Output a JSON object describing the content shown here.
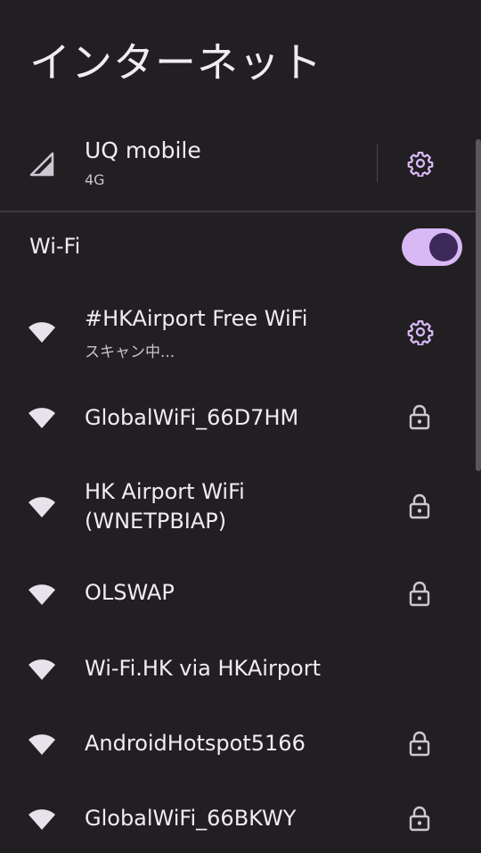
{
  "page": {
    "title": "インターネット"
  },
  "carrier": {
    "name": "UQ mobile",
    "network_type": "4G"
  },
  "wifi": {
    "label": "Wi-Fi",
    "enabled": true
  },
  "networks": [
    {
      "name": "#HKAirport Free WiFi",
      "status": "スキャン中...",
      "secured": false,
      "has_settings": true
    },
    {
      "name": "GlobalWiFi_66D7HM",
      "secured": true
    },
    {
      "name_line1": "HK Airport WiFi",
      "name_line2": "(WNETPBIAP)",
      "secured": true
    },
    {
      "name": "OLSWAP",
      "secured": true
    },
    {
      "name": "Wi-Fi.HK via HKAirport",
      "secured": false
    },
    {
      "name": "AndroidHotspot5166",
      "secured": true
    },
    {
      "name": "GlobalWiFi_66BKWY",
      "secured": true
    }
  ],
  "colors": {
    "background": "#221f23",
    "accent": "#d9b9f5",
    "text": "#f1ecf3",
    "secondary_text": "#c9c2cc"
  },
  "icons": {
    "signal": "signal-icon",
    "settings": "gear-icon",
    "wifi": "wifi-icon",
    "lock": "lock-icon"
  }
}
